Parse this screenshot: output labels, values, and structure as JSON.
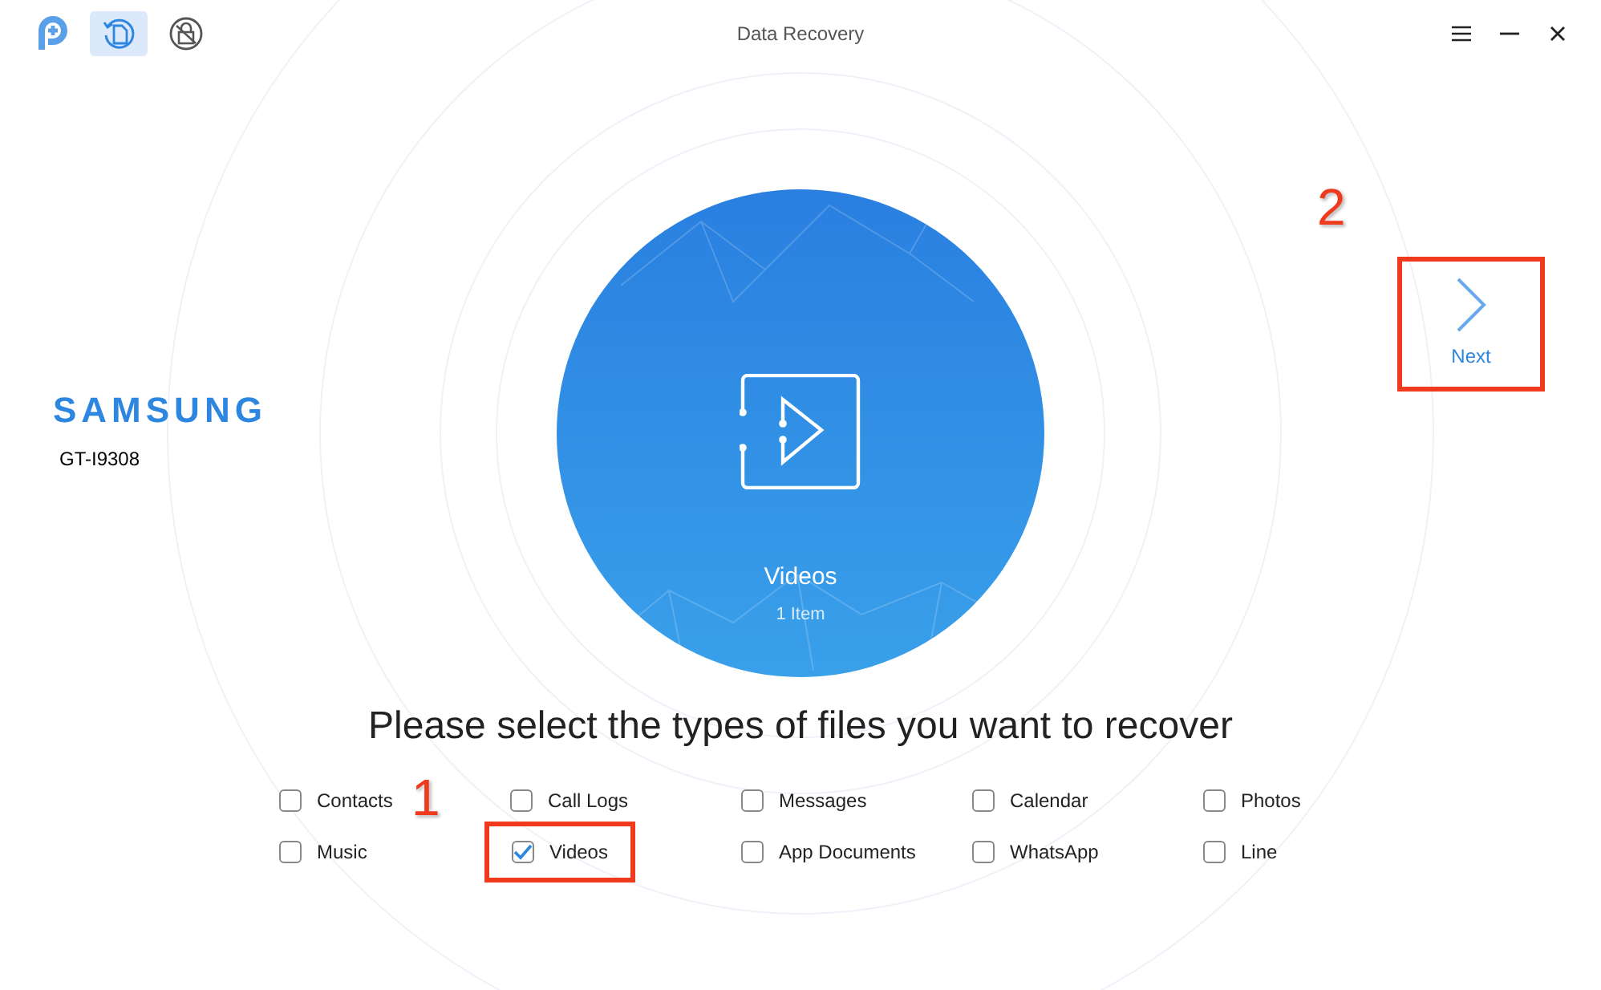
{
  "window": {
    "title": "Data Recovery"
  },
  "toolbar": [
    {
      "kind": "logo",
      "selected": false
    },
    {
      "kind": "recovery",
      "selected": true
    },
    {
      "kind": "unlock",
      "selected": false
    }
  ],
  "device": {
    "brand": "SAMSUNG",
    "model": "GT-I9308"
  },
  "category": {
    "name": "Videos",
    "count": "1 Item"
  },
  "next": {
    "label": "Next",
    "highlighted": true,
    "annotation": "2"
  },
  "heading": "Please select the types of files you want to recover",
  "file_types": [
    {
      "label": "Contacts",
      "checked": false,
      "highlighted": false
    },
    {
      "label": "Call Logs",
      "checked": false,
      "highlighted": false
    },
    {
      "label": "Messages",
      "checked": false,
      "highlighted": false
    },
    {
      "label": "Calendar",
      "checked": false,
      "highlighted": false
    },
    {
      "label": "Photos",
      "checked": false,
      "highlighted": false
    },
    {
      "label": "Music",
      "checked": false,
      "highlighted": false
    },
    {
      "label": "Videos",
      "checked": true,
      "highlighted": true
    },
    {
      "label": "App Documents",
      "checked": false,
      "highlighted": false
    },
    {
      "label": "WhatsApp",
      "checked": false,
      "highlighted": false
    },
    {
      "label": "Line",
      "checked": false,
      "highlighted": false
    }
  ],
  "file_types_annotation": "1"
}
